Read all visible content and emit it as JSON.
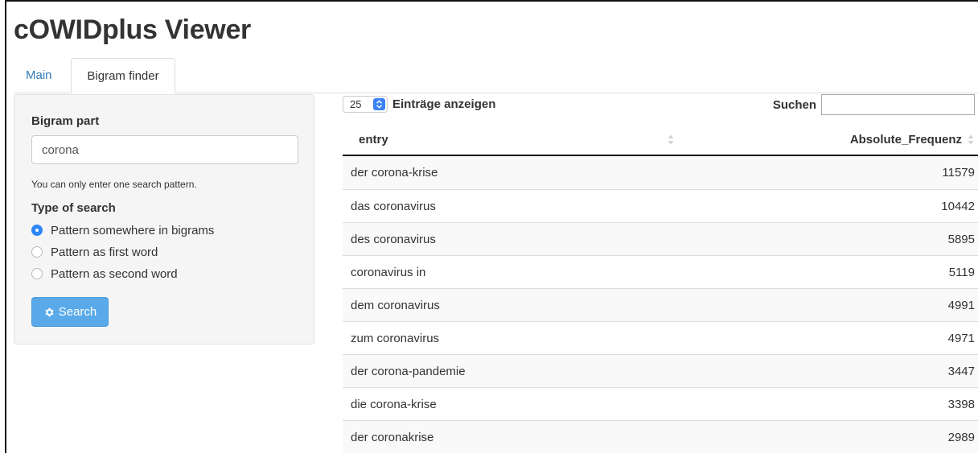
{
  "app": {
    "title": "cOWIDplus Viewer"
  },
  "tabs": [
    {
      "label": "Main",
      "active": false
    },
    {
      "label": "Bigram finder",
      "active": true
    }
  ],
  "sidebar": {
    "bigram_label": "Bigram part",
    "bigram_value": "corona",
    "help_text": "You can only enter one search pattern.",
    "type_label": "Type of search",
    "options": [
      {
        "label": "Pattern somewhere in bigrams",
        "checked": true
      },
      {
        "label": "Pattern as first word",
        "checked": false
      },
      {
        "label": "Pattern as second word",
        "checked": false
      }
    ],
    "search_button": "Search",
    "search_icon": "gear-icon"
  },
  "table": {
    "length_value": "25",
    "length_label": "Einträge anzeigen",
    "search_label": "Suchen",
    "search_value": "",
    "columns": [
      "entry",
      "Absolute_Frequenz"
    ],
    "rows": [
      {
        "entry": "der corona-krise",
        "freq": "11579"
      },
      {
        "entry": "das coronavirus",
        "freq": "10442"
      },
      {
        "entry": "des coronavirus",
        "freq": "5895"
      },
      {
        "entry": "coronavirus in",
        "freq": "5119"
      },
      {
        "entry": "dem coronavirus",
        "freq": "4991"
      },
      {
        "entry": "zum coronavirus",
        "freq": "4971"
      },
      {
        "entry": "der corona-pandemie",
        "freq": "3447"
      },
      {
        "entry": "die corona-krise",
        "freq": "3398"
      },
      {
        "entry": "der coronakrise",
        "freq": "2989"
      }
    ]
  },
  "colors": {
    "link": "#337ab7",
    "button": "#5aaaea",
    "radio_selected": "#2f86f6"
  }
}
